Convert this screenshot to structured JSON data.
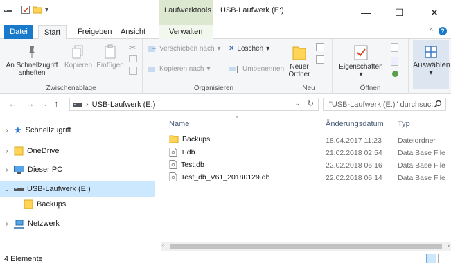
{
  "window": {
    "title": "USB-Laufwerk (E:)",
    "context_tab_header": "Laufwerktools"
  },
  "tabs": [
    {
      "label": "Datei"
    },
    {
      "label": "Start"
    },
    {
      "label": "Freigeben"
    },
    {
      "label": "Ansicht"
    },
    {
      "label": "Verwalten"
    }
  ],
  "ribbon": {
    "clipboard": {
      "label": "Zwischenablage",
      "pin_line1": "An Schnellzugriff",
      "pin_line2": "anheften",
      "copy": "Kopieren",
      "paste": "Einfügen"
    },
    "organize": {
      "label": "Organisieren",
      "move_to": "Verschieben nach",
      "copy_to": "Kopieren nach",
      "delete": "Löschen",
      "rename": "Umbenennen"
    },
    "new": {
      "label": "Neu",
      "folder_line1": "Neuer",
      "folder_line2": "Ordner"
    },
    "open": {
      "label": "Öffnen",
      "properties": "Eigenschaften"
    },
    "select": {
      "label": "Auswählen"
    }
  },
  "address": {
    "path": "USB-Laufwerk (E:)",
    "search_placeholder": "\"USB-Laufwerk (E:)\" durchsuc..."
  },
  "nav": [
    {
      "label": "Schnellzugriff",
      "icon": "star-icon"
    },
    {
      "label": "OneDrive",
      "icon": "folder-icon"
    },
    {
      "label": "Dieser PC",
      "icon": "monitor-icon"
    },
    {
      "label": "USB-Laufwerk (E:)",
      "icon": "drive-icon"
    },
    {
      "label": "Backups",
      "icon": "folder-icon"
    },
    {
      "label": "Netzwerk",
      "icon": "network-icon"
    }
  ],
  "columns": {
    "name": "Name",
    "date": "Änderungsdatum",
    "type": "Typ"
  },
  "files": [
    {
      "name": "Backups",
      "date": "18.04.2017 11:23",
      "type": "Dateiordner",
      "icon": "folder-icon"
    },
    {
      "name": "1.db",
      "date": "21.02.2018 02:54",
      "type": "Data Base File",
      "icon": "file-icon"
    },
    {
      "name": "Test.db",
      "date": "22.02.2018 06:16",
      "type": "Data Base File",
      "icon": "file-icon"
    },
    {
      "name": "Test_db_V61_20180129.db",
      "date": "22.02.2018 06:14",
      "type": "Data Base File",
      "icon": "file-icon"
    }
  ],
  "status": {
    "count": "4 Elemente"
  },
  "colors": {
    "accent": "#1979ca",
    "context_tab": "#dce9d0",
    "selection": "#cce8ff",
    "folder": "#ffd457"
  }
}
